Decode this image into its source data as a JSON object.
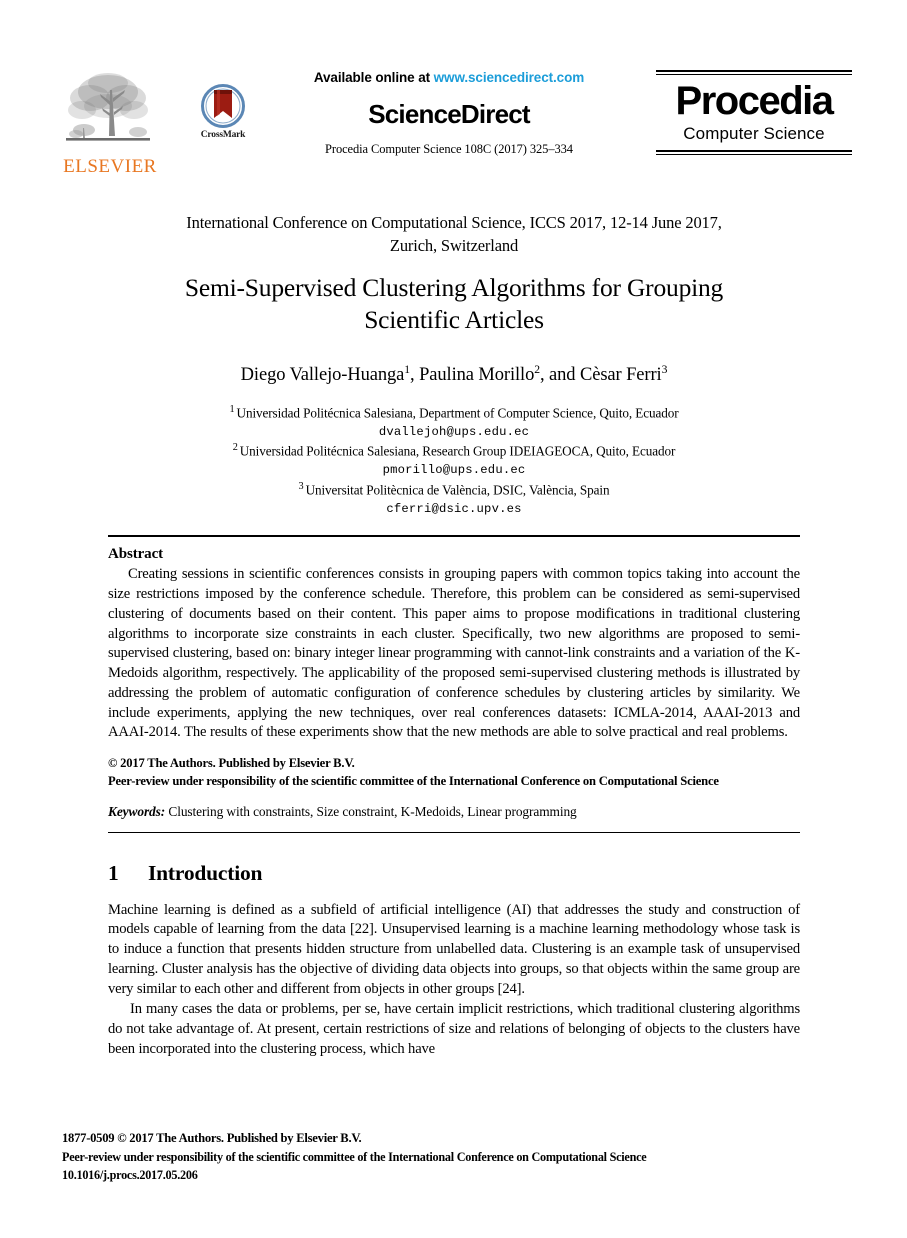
{
  "masthead": {
    "elsevier": {
      "wordmark": "ELSEVIER",
      "tree_icon": "tree-icon",
      "color": "#E87722"
    },
    "crossmark": {
      "label": "CrossMark",
      "icon": "crossmark-bookmark-icon",
      "ring_color": "#5B87B5",
      "ribbon_color": "#9C1C12"
    },
    "available_online_prefix": "Available online at ",
    "available_online_url": "www.sciencedirect.com",
    "url_color": "#1b9dd9",
    "sciencedirect_wordmark": "ScienceDirect",
    "citation": "Procedia Computer Science 108C (2017) 325–334",
    "procedia": {
      "title": "Procedia",
      "subtitle": "Computer Science"
    }
  },
  "frontmatter": {
    "conference_line1": "International Conference on Computational Science, ICCS 2017, 12-14 June 2017,",
    "conference_line2": "Zurich, Switzerland",
    "title_line1": "Semi-Supervised Clustering Algorithms for Grouping",
    "title_line2": "Scientific Articles",
    "authors_text": "Diego Vallejo-Huanga",
    "authors_full": [
      {
        "name": "Diego Vallejo-Huanga",
        "marker": "1",
        "separator": ", "
      },
      {
        "name": "Paulina Morillo",
        "marker": "2",
        "separator": ", and "
      },
      {
        "name": "Cèsar Ferri",
        "marker": "3",
        "separator": ""
      }
    ],
    "affiliations": [
      {
        "marker": "1",
        "text": "Universidad Politécnica Salesiana, Department of Computer Science, Quito, Ecuador",
        "email": "dvallejoh@ups.edu.ec"
      },
      {
        "marker": "2",
        "text": "Universidad Politécnica Salesiana, Research Group IDEIAGEOCA, Quito, Ecuador",
        "email": "pmorillo@ups.edu.ec"
      },
      {
        "marker": "3",
        "text": "Universitat Politècnica de València, DSIC, València, Spain",
        "email": "cferri@dsic.upv.es"
      }
    ]
  },
  "abstract": {
    "heading": "Abstract",
    "text": "Creating sessions in scientific conferences consists in grouping papers with common topics taking into account the size restrictions imposed by the conference schedule. Therefore, this problem can be considered as semi-supervised clustering of documents based on their content. This paper aims to propose modifications in traditional clustering algorithms to incorporate size constraints in each cluster. Specifically, two new algorithms are proposed to semi-supervised clustering, based on: binary integer linear programming with cannot-link constraints and a variation of the K-Medoids algorithm, respectively. The applicability of the proposed semi-supervised clustering methods is illustrated by addressing the problem of automatic configuration of conference schedules by clustering articles by similarity. We include experiments, applying the new techniques, over real conferences datasets: ICMLA-2014, AAAI-2013 and AAAI-2014. The results of these experiments show that the new methods are able to solve practical and real problems.",
    "copyright_line1": "© 2017 The Authors. Published by Elsevier B.V.",
    "copyright_line2": "Peer-review under responsibility of the scientific committee of the International Conference on Computational Science",
    "keywords_label": "Keywords:",
    "keywords_text": " Clustering with constraints, Size constraint, K-Medoids, Linear programming"
  },
  "section1": {
    "number": "1",
    "heading": "Introduction",
    "paragraph1": "Machine learning is defined as a subfield of artificial intelligence (AI) that addresses the study and construction of models capable of learning from the data [22]. Unsupervised learning is a machine learning methodology whose task is to induce a function that presents hidden structure from unlabelled data. Clustering is an example task of unsupervised learning. Cluster analysis has the objective of dividing data objects into groups, so that objects within the same group are very similar to each other and different from objects in other groups [24].",
    "paragraph2": "In many cases the data or problems, per se, have certain implicit restrictions, which traditional clustering algorithms do not take advantage of. At present, certain restrictions of size and relations of belonging of objects to the clusters have been incorporated into the clustering process, which have"
  },
  "footer": {
    "line1": "1877-0509 © 2017 The Authors. Published by Elsevier B.V.",
    "line2": "Peer-review under responsibility of the scientific committee of the International Conference on Computational Science",
    "line3": "10.1016/j.procs.2017.05.206"
  }
}
